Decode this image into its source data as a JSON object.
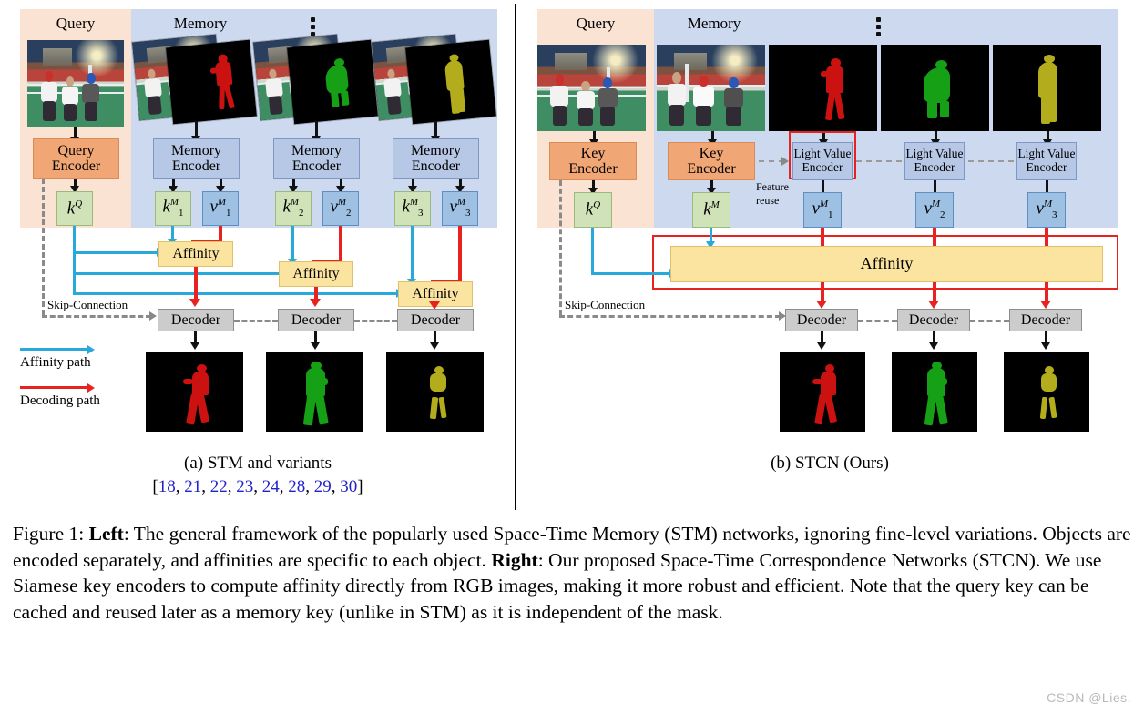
{
  "figure": {
    "panel_a": {
      "id": "a",
      "headers": {
        "query": "Query",
        "memory": "Memory"
      },
      "ellipsis": "vertical-dots",
      "encoders": {
        "query": "Query\nEncoder",
        "memory_1": "Memory\nEncoder",
        "memory_2": "Memory\nEncoder",
        "memory_3": "Memory\nEncoder"
      },
      "features": {
        "kq": {
          "sym": "k",
          "sup": "Q",
          "sub": ""
        },
        "k1m": {
          "sym": "k",
          "sup": "M",
          "sub": "1"
        },
        "v1m": {
          "sym": "v",
          "sup": "M",
          "sub": "1"
        },
        "k2m": {
          "sym": "k",
          "sup": "M",
          "sub": "2"
        },
        "v2m": {
          "sym": "v",
          "sup": "M",
          "sub": "2"
        },
        "k3m": {
          "sym": "k",
          "sup": "M",
          "sub": "3"
        },
        "v3m": {
          "sym": "v",
          "sup": "M",
          "sub": "3"
        }
      },
      "affinity_blocks": [
        "Affinity",
        "Affinity",
        "Affinity"
      ],
      "decoders": [
        "Decoder",
        "Decoder",
        "Decoder"
      ],
      "skip_label": "Skip-Connection",
      "legend": [
        {
          "label": "Affinity path",
          "color": "#29a8dc"
        },
        {
          "label": "Decoding path",
          "color": "#e8231f"
        }
      ],
      "subcaption": "(a) STM and variants",
      "citations": {
        "open": "[",
        "close": "]",
        "items": [
          "18",
          "21",
          "22",
          "23",
          "24",
          "28",
          "29",
          "30"
        ],
        "sep": ", "
      }
    },
    "panel_b": {
      "id": "b",
      "headers": {
        "query": "Query",
        "memory": "Memory"
      },
      "ellipsis": "vertical-dots",
      "encoders": {
        "key_query": "Key\nEncoder",
        "key_memory": "Key\nEncoder",
        "value_1": "Light Value\nEncoder",
        "value_2": "Light Value\nEncoder",
        "value_3": "Light Value\nEncoder"
      },
      "feature_reuse_label": "Feature\nreuse",
      "features": {
        "kq": {
          "sym": "k",
          "sup": "Q",
          "sub": ""
        },
        "km": {
          "sym": "k",
          "sup": "M",
          "sub": ""
        },
        "v1m": {
          "sym": "v",
          "sup": "M",
          "sub": "1"
        },
        "v2m": {
          "sym": "v",
          "sup": "M",
          "sub": "2"
        },
        "v3m": {
          "sym": "v",
          "sup": "M",
          "sub": "3"
        }
      },
      "affinity_block": "Affinity",
      "decoders": [
        "Decoder",
        "Decoder",
        "Decoder"
      ],
      "skip_label": "Skip-Connection",
      "subcaption": "(b) STCN (Ours)"
    },
    "colors": {
      "query_bg": "#fbe3d4",
      "memory_bg": "#ccd9ef",
      "query_encoder": "#f0a675",
      "memory_encoder": "#b7c8e6",
      "key_feature": "#cfe2b8",
      "value_feature": "#9dc0e3",
      "affinity": "#fbe3a0",
      "decoder": "#cccccc",
      "affinity_path": "#29a8dc",
      "decoding_path": "#e8231f",
      "highlight": "#e8231f",
      "skip": "#8a8a8a",
      "citation_text": "#2222cc",
      "mask_red": "#cc1111",
      "mask_green": "#16a016",
      "mask_olive": "#b3ac1c"
    }
  },
  "caption": {
    "label": "Figure 1: ",
    "bold_left": "Left",
    "text_left": ": The general framework of the popularly used Space-Time Memory (STM) networks, ignoring fine-level variations. Objects are encoded separately, and affinities are specific to each object. ",
    "bold_right": "Right",
    "text_right": ": Our proposed Space-Time Correspondence Networks (STCN). We use Siamese key encoders to compute affinity directly from RGB images, making it more robust and efficient. Note that the query key can be cached and reused later as a memory key (unlike in STM) as it is independent of the mask."
  },
  "watermark": "CSDN @Lies."
}
